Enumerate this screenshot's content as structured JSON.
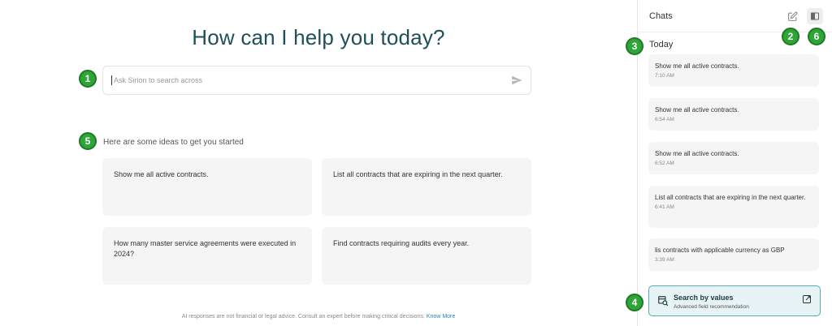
{
  "main": {
    "title": "How can I help you today?",
    "search": {
      "placeholder": "Ask Sirion to search across"
    },
    "ideas_label": "Here are some ideas to get you started",
    "ideas": [
      {
        "text": "Show me all active contracts."
      },
      {
        "text": "List all contracts that are expiring in the next quarter."
      },
      {
        "text": "How many master service agreements were executed in 2024?"
      },
      {
        "text": "Find contracts requiring audits every year."
      }
    ],
    "disclaimer": "AI responses are not financial or legal advice. Consult an expert before making critical decisions.",
    "know_more": "Know More"
  },
  "sidebar": {
    "title": "Chats",
    "section": "Today",
    "chats": [
      {
        "msg": "Show me all active contracts.",
        "time": "7:10 AM"
      },
      {
        "msg": "Show me all active contracts.",
        "time": "6:54 AM"
      },
      {
        "msg": "Show me all active contracts.",
        "time": "6:52 AM"
      },
      {
        "msg": "List all contracts that are expiring in the next quarter.",
        "time": "6:41 AM"
      },
      {
        "msg": "lis contracts with  applicable currency as GBP",
        "time": "3:39 AM"
      }
    ],
    "search_by_values": {
      "title": "Search by values",
      "subtitle": "Advanced field recommendation"
    }
  },
  "badges": [
    "1",
    "2",
    "3",
    "4",
    "5",
    "6"
  ],
  "colors": {
    "accent": "#1e4f5a",
    "badge": "#2fa538",
    "card": "#f5f5f5",
    "sbv_border": "#5aa8b8"
  }
}
